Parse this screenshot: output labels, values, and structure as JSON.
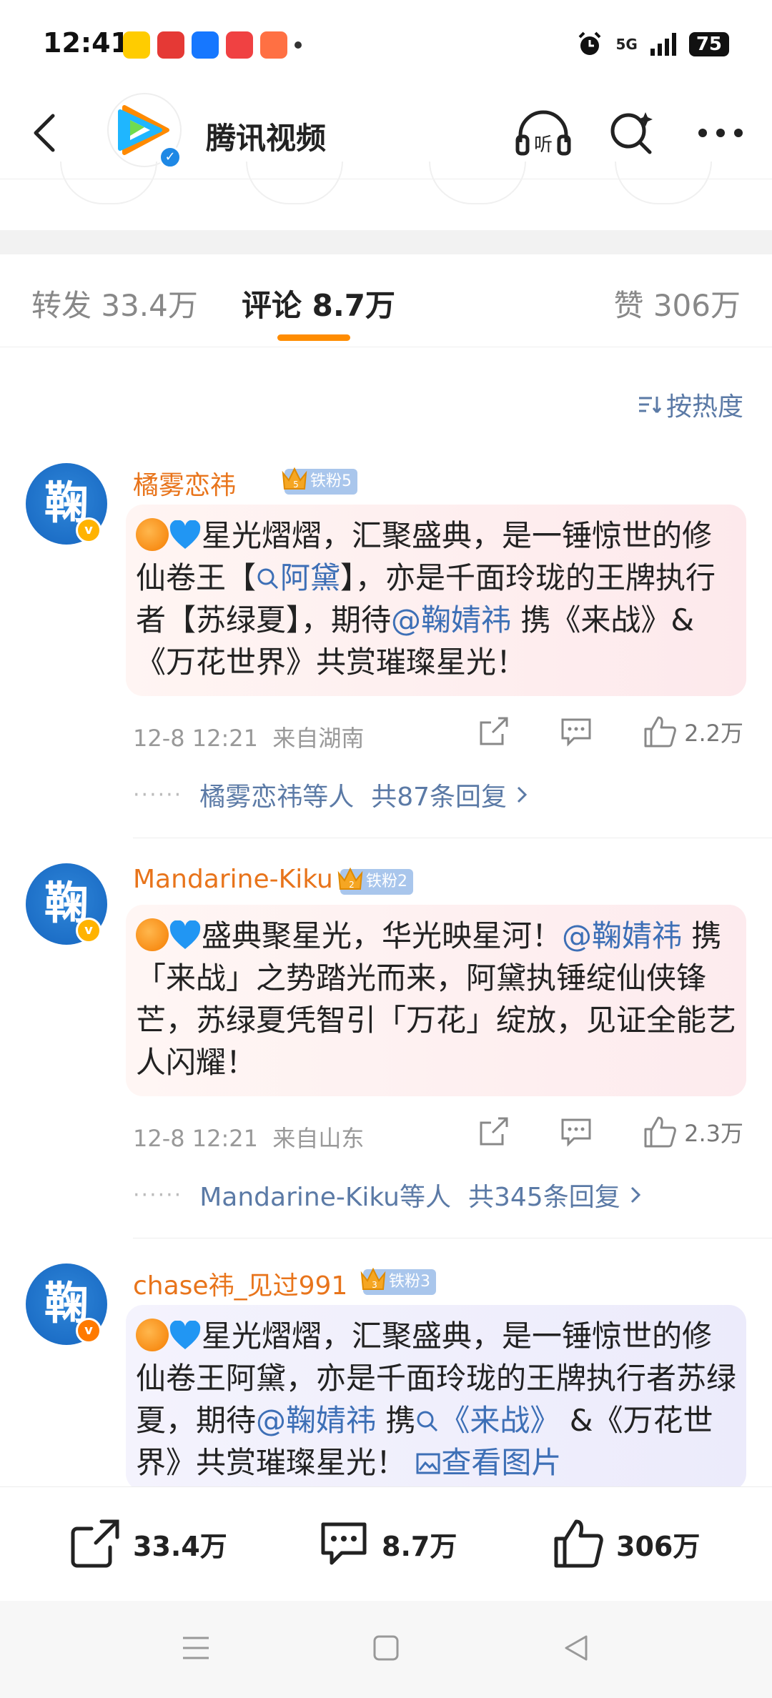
{
  "status_bar": {
    "time": "12:41",
    "network": "5G",
    "battery": "75"
  },
  "header": {
    "title": "腾讯视频"
  },
  "tabs": {
    "repost": "转发 33.4万",
    "comments": "评论 8.7万",
    "likes": "赞 306万"
  },
  "sort_label": "按热度",
  "comments": [
    {
      "username": "橘雾恋祎",
      "fan_badge": "铁粉5",
      "crown_level": "5",
      "text_parts": [
        "星光熠熠，汇聚盛典，是一锤惊世的修仙卷王【",
        "阿黛",
        "】，亦是千面玲珑的王牌执行者【苏绿夏】，期待",
        "@鞠婧祎",
        " 携《来战》&《万花世界》共赏璀璨星光！"
      ],
      "time": "12-8 12:21",
      "location": "来自湖南",
      "likes": "2.2万",
      "reply_users": "橘雾恋祎等人",
      "reply_count": "共87条回复"
    },
    {
      "username": "Mandarine-Kiku",
      "fan_badge": "铁粉2",
      "crown_level": "2",
      "text_parts": [
        "盛典聚星光，华光映星河！",
        "@鞠婧祎",
        " 携「来战」之势踏光而来，阿黛执锤绽仙侠锋芒，苏绿夏凭智引「万花」绽放，见证全能艺人闪耀！"
      ],
      "time": "12-8 12:21",
      "location": "来自山东",
      "likes": "2.3万",
      "reply_users": "Mandarine-Kiku等人",
      "reply_count": "共345条回复"
    },
    {
      "username": "chase祎_见过991",
      "fan_badge": "铁粉3",
      "crown_level": "3",
      "text_parts": [
        "星光熠熠，汇聚盛典，是一锤惊世的修仙卷王阿黛，亦是千面玲珑的王牌执行者苏绿夏，期待",
        "@鞠婧祎",
        " 携",
        "《来战》",
        " &《万花世界》共赏璀璨星光！ ",
        "查看图片"
      ]
    }
  ],
  "bottom_bar": {
    "repost_count": "33.4万",
    "comment_count": "8.7万",
    "like_count": "306万"
  },
  "avatar_char": "鞠",
  "colors": {
    "accent": "#ff8c00",
    "username": "#e8741b",
    "link": "#3d6fb6"
  }
}
